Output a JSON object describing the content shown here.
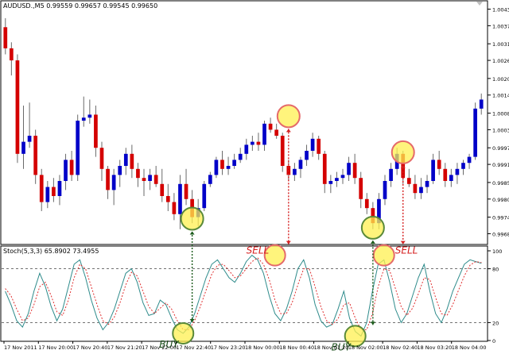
{
  "chart_data": [
    {
      "type": "candlestick",
      "title": "AUDUSD.,M5  0.99559 0.99657 0.99545 0.99650",
      "colors": {
        "bull": "#0000c8",
        "bear": "#d40000",
        "wick": "#6a6a6a",
        "background": "#ffffff"
      },
      "ylim": [
        0.99652,
        1.00455
      ],
      "y_ticks": [
        "1.00430",
        "1.00375",
        "1.00315",
        "1.00260",
        "1.00200",
        "1.00145",
        "1.00085",
        "1.00030",
        "0.99970",
        "0.99915",
        "0.99855",
        "0.99800",
        "0.99740",
        "0.99685"
      ],
      "candles": [
        {
          "o": 1.0037,
          "h": 1.004,
          "l": 1.0028,
          "c": 1.003
        },
        {
          "o": 1.003,
          "h": 1.0032,
          "l": 1.0021,
          "c": 1.0026
        },
        {
          "o": 1.0026,
          "h": 1.0028,
          "l": 0.9992,
          "c": 0.9995
        },
        {
          "o": 0.9995,
          "h": 1.0011,
          "l": 0.999,
          "c": 0.9999
        },
        {
          "o": 0.9999,
          "h": 1.0012,
          "l": 0.9997,
          "c": 1.0001
        },
        {
          "o": 1.0001,
          "h": 1.0003,
          "l": 0.9985,
          "c": 0.9988
        },
        {
          "o": 0.9988,
          "h": 0.999,
          "l": 0.9976,
          "c": 0.9979
        },
        {
          "o": 0.9979,
          "h": 0.9986,
          "l": 0.9977,
          "c": 0.9984
        },
        {
          "o": 0.9984,
          "h": 0.9987,
          "l": 0.9979,
          "c": 0.9981
        },
        {
          "o": 0.9981,
          "h": 0.9988,
          "l": 0.9978,
          "c": 0.9986
        },
        {
          "o": 0.9986,
          "h": 0.9995,
          "l": 0.9983,
          "c": 0.9993
        },
        {
          "o": 0.9993,
          "h": 0.9996,
          "l": 0.9986,
          "c": 0.9988
        },
        {
          "o": 0.9988,
          "h": 1.0008,
          "l": 0.9986,
          "c": 1.0006
        },
        {
          "o": 1.0006,
          "h": 1.0014,
          "l": 1.0004,
          "c": 1.0007
        },
        {
          "o": 1.0007,
          "h": 1.0013,
          "l": 1.0005,
          "c": 1.0008
        },
        {
          "o": 1.0008,
          "h": 1.0011,
          "l": 0.9994,
          "c": 0.9997
        },
        {
          "o": 0.9997,
          "h": 0.9999,
          "l": 0.9986,
          "c": 0.999
        },
        {
          "o": 0.999,
          "h": 0.9991,
          "l": 0.998,
          "c": 0.9983
        },
        {
          "o": 0.9983,
          "h": 0.999,
          "l": 0.9978,
          "c": 0.9988
        },
        {
          "o": 0.9988,
          "h": 0.9993,
          "l": 0.9984,
          "c": 0.9991
        },
        {
          "o": 0.9991,
          "h": 0.9997,
          "l": 0.9988,
          "c": 0.9995
        },
        {
          "o": 0.9995,
          "h": 0.9998,
          "l": 0.9987,
          "c": 0.999
        },
        {
          "o": 0.999,
          "h": 0.9992,
          "l": 0.9984,
          "c": 0.9987
        },
        {
          "o": 0.9987,
          "h": 0.999,
          "l": 0.9981,
          "c": 0.9986
        },
        {
          "o": 0.9986,
          "h": 0.999,
          "l": 0.9983,
          "c": 0.9988
        },
        {
          "o": 0.9988,
          "h": 0.9991,
          "l": 0.9984,
          "c": 0.9985
        },
        {
          "o": 0.9985,
          "h": 0.999,
          "l": 0.9979,
          "c": 0.9981
        },
        {
          "o": 0.9981,
          "h": 0.9985,
          "l": 0.9976,
          "c": 0.9979
        },
        {
          "o": 0.9979,
          "h": 0.9982,
          "l": 0.9973,
          "c": 0.9975
        },
        {
          "o": 0.9975,
          "h": 0.9988,
          "l": 0.997,
          "c": 0.9985
        },
        {
          "o": 0.9985,
          "h": 0.999,
          "l": 0.9978,
          "c": 0.998
        },
        {
          "o": 0.998,
          "h": 0.9983,
          "l": 0.9972,
          "c": 0.9974
        },
        {
          "o": 0.9974,
          "h": 0.998,
          "l": 0.9971,
          "c": 0.9977
        },
        {
          "o": 0.9977,
          "h": 0.9986,
          "l": 0.9976,
          "c": 0.9985
        },
        {
          "o": 0.9985,
          "h": 0.9989,
          "l": 0.9984,
          "c": 0.9988
        },
        {
          "o": 0.9988,
          "h": 0.9994,
          "l": 0.9987,
          "c": 0.9993
        },
        {
          "o": 0.9993,
          "h": 0.9996,
          "l": 0.9988,
          "c": 0.999
        },
        {
          "o": 0.999,
          "h": 0.9994,
          "l": 0.9988,
          "c": 0.9991
        },
        {
          "o": 0.9991,
          "h": 0.9995,
          "l": 0.999,
          "c": 0.9993
        },
        {
          "o": 0.9993,
          "h": 0.9997,
          "l": 0.9992,
          "c": 0.9995
        },
        {
          "o": 0.9995,
          "h": 1.0,
          "l": 0.9993,
          "c": 0.9998
        },
        {
          "o": 0.9998,
          "h": 1.0001,
          "l": 0.9996,
          "c": 0.9999
        },
        {
          "o": 0.9999,
          "h": 1.0002,
          "l": 0.9996,
          "c": 0.9998
        },
        {
          "o": 0.9998,
          "h": 1.0006,
          "l": 0.9996,
          "c": 1.0005
        },
        {
          "o": 1.0005,
          "h": 1.0007,
          "l": 1.0002,
          "c": 1.0003
        },
        {
          "o": 1.0003,
          "h": 1.0005,
          "l": 1.0,
          "c": 1.0001
        },
        {
          "o": 1.0001,
          "h": 1.0002,
          "l": 0.9989,
          "c": 0.9991
        },
        {
          "o": 0.9991,
          "h": 0.9993,
          "l": 0.9986,
          "c": 0.9988
        },
        {
          "o": 0.9988,
          "h": 0.9992,
          "l": 0.9986,
          "c": 0.999
        },
        {
          "o": 0.999,
          "h": 0.9994,
          "l": 0.9987,
          "c": 0.9993
        },
        {
          "o": 0.9993,
          "h": 0.9998,
          "l": 0.9991,
          "c": 0.9996
        },
        {
          "o": 0.9996,
          "h": 1.0002,
          "l": 0.9994,
          "c": 1.0
        },
        {
          "o": 1.0,
          "h": 1.0001,
          "l": 0.9993,
          "c": 0.9995
        },
        {
          "o": 0.9995,
          "h": 0.9996,
          "l": 0.9982,
          "c": 0.9985
        },
        {
          "o": 0.9985,
          "h": 0.9988,
          "l": 0.9982,
          "c": 0.9986
        },
        {
          "o": 0.9986,
          "h": 0.9989,
          "l": 0.9984,
          "c": 0.9987
        },
        {
          "o": 0.9987,
          "h": 0.999,
          "l": 0.9985,
          "c": 0.9988
        },
        {
          "o": 0.9988,
          "h": 0.9994,
          "l": 0.9986,
          "c": 0.9992
        },
        {
          "o": 0.9992,
          "h": 0.9995,
          "l": 0.9985,
          "c": 0.9987
        },
        {
          "o": 0.9987,
          "h": 0.9989,
          "l": 0.9977,
          "c": 0.998
        },
        {
          "o": 0.998,
          "h": 0.9982,
          "l": 0.9975,
          "c": 0.9977
        },
        {
          "o": 0.9977,
          "h": 0.9979,
          "l": 0.997,
          "c": 0.9972
        },
        {
          "o": 0.9972,
          "h": 0.9982,
          "l": 0.997,
          "c": 0.998
        },
        {
          "o": 0.998,
          "h": 0.9988,
          "l": 0.9978,
          "c": 0.9986
        },
        {
          "o": 0.9986,
          "h": 0.9992,
          "l": 0.9984,
          "c": 0.999
        },
        {
          "o": 0.999,
          "h": 0.9997,
          "l": 0.9988,
          "c": 0.9995
        },
        {
          "o": 0.9995,
          "h": 0.9996,
          "l": 0.9985,
          "c": 0.9987
        },
        {
          "o": 0.9987,
          "h": 0.999,
          "l": 0.9984,
          "c": 0.9985
        },
        {
          "o": 0.9985,
          "h": 0.9988,
          "l": 0.998,
          "c": 0.9982
        },
        {
          "o": 0.9982,
          "h": 0.9987,
          "l": 0.998,
          "c": 0.9984
        },
        {
          "o": 0.9984,
          "h": 0.9988,
          "l": 0.9982,
          "c": 0.9986
        },
        {
          "o": 0.9986,
          "h": 0.9995,
          "l": 0.9985,
          "c": 0.9993
        },
        {
          "o": 0.9993,
          "h": 0.9996,
          "l": 0.9988,
          "c": 0.999
        },
        {
          "o": 0.999,
          "h": 0.9992,
          "l": 0.9984,
          "c": 0.9986
        },
        {
          "o": 0.9986,
          "h": 0.999,
          "l": 0.9984,
          "c": 0.9988
        },
        {
          "o": 0.9988,
          "h": 0.9992,
          "l": 0.9985,
          "c": 0.999
        },
        {
          "o": 0.999,
          "h": 0.9993,
          "l": 0.9988,
          "c": 0.9992
        },
        {
          "o": 0.9992,
          "h": 0.9995,
          "l": 0.999,
          "c": 0.9994
        },
        {
          "o": 0.9994,
          "h": 1.0012,
          "l": 0.9993,
          "c": 1.001
        },
        {
          "o": 1.001,
          "h": 1.0015,
          "l": 1.0008,
          "c": 1.0013
        }
      ],
      "annotations": [
        {
          "kind": "circle",
          "candle": 31,
          "value": 0.99735,
          "label": "BUY"
        },
        {
          "kind": "circle",
          "candle": 47,
          "value": 1.00075,
          "label": "SELL"
        },
        {
          "kind": "circle",
          "candle": 61,
          "value": 0.99705,
          "label": "BUY"
        },
        {
          "kind": "circle",
          "candle": 66,
          "value": 0.99955,
          "label": "SELL"
        }
      ]
    },
    {
      "type": "line",
      "title": "Stoch(5,3,3) 65.8902 73.4955",
      "ylim": [
        0,
        100
      ],
      "y_ticks": [
        "100",
        "80",
        "20",
        "0"
      ],
      "levels": [
        80,
        20
      ],
      "x_tick_labels": [
        "17 Nov 2011",
        "17 Nov 20:00",
        "17 Nov 20:40",
        "17 Nov 21:20",
        "17 Nov 22:00",
        "17 Nov 22:40",
        "17 Nov 23:20",
        "18 Nov 00:00",
        "18 Nov 00:40",
        "18 Nov 01:20",
        "18 Nov 02:00",
        "18 Nov 02:40",
        "18 Nov 03:20",
        "18 Nov 04:00"
      ],
      "series": [
        {
          "color": "#2e8b8b",
          "style": "solid",
          "values": [
            55,
            40,
            22,
            15,
            30,
            55,
            75,
            60,
            38,
            22,
            35,
            60,
            85,
            90,
            70,
            45,
            25,
            12,
            20,
            35,
            55,
            75,
            80,
            65,
            42,
            28,
            30,
            45,
            40,
            25,
            12,
            8,
            15,
            30,
            50,
            70,
            85,
            90,
            80,
            70,
            65,
            75,
            88,
            95,
            90,
            75,
            50,
            30,
            22,
            35,
            55,
            80,
            90,
            70,
            40,
            22,
            15,
            18,
            35,
            55,
            25,
            10,
            5,
            20,
            55,
            85,
            90,
            65,
            35,
            20,
            30,
            50,
            70,
            85,
            55,
            30,
            20,
            35,
            55,
            70,
            85,
            90,
            88,
            86
          ]
        },
        {
          "color": "#e03030",
          "style": "dashed",
          "values": [
            58,
            50,
            35,
            22,
            25,
            40,
            60,
            65,
            50,
            32,
            28,
            45,
            70,
            85,
            80,
            60,
            40,
            22,
            18,
            26,
            42,
            62,
            76,
            72,
            55,
            38,
            30,
            36,
            42,
            35,
            22,
            12,
            12,
            22,
            38,
            56,
            74,
            84,
            85,
            78,
            70,
            72,
            80,
            88,
            92,
            85,
            68,
            45,
            30,
            30,
            42,
            62,
            80,
            80,
            60,
            38,
            22,
            18,
            24,
            40,
            42,
            25,
            12,
            12,
            30,
            60,
            80,
            78,
            58,
            38,
            28,
            36,
            52,
            70,
            68,
            48,
            30,
            28,
            40,
            56,
            72,
            84,
            88,
            87
          ]
        }
      ],
      "annotations": [
        {
          "kind": "circle",
          "index": 31,
          "value": 8,
          "label": "BUY"
        },
        {
          "kind": "circle",
          "index": 47,
          "value": 95,
          "label": "SELL"
        },
        {
          "kind": "circle",
          "index": 61,
          "value": 5,
          "label": "BUY"
        },
        {
          "kind": "circle",
          "index": 66,
          "value": 95,
          "label": "SELL"
        }
      ]
    }
  ]
}
